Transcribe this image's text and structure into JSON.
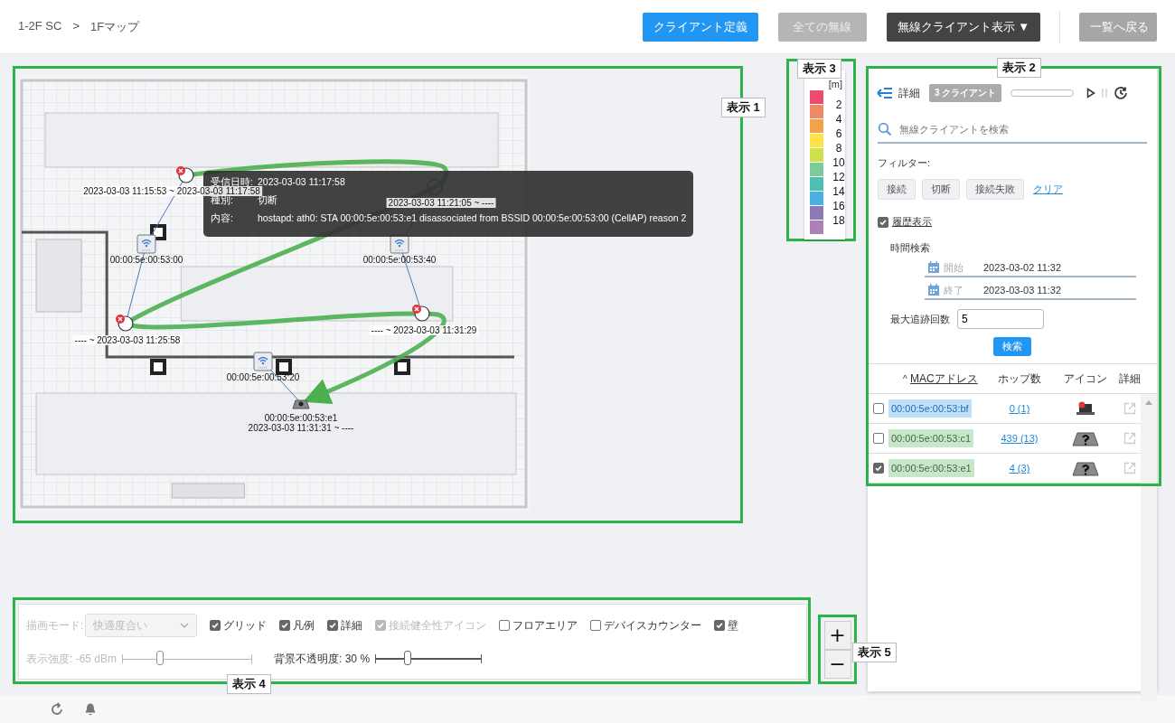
{
  "breadcrumb": {
    "items": [
      "1-2F SC",
      "1Fマップ"
    ],
    "separator": ">"
  },
  "header_buttons": [
    {
      "label": "クライアント定義",
      "kind": "primary"
    },
    {
      "label": "全ての無線",
      "kind": "disabled"
    },
    {
      "label": "無線クライアント表示 ▼",
      "kind": "dark"
    },
    {
      "label": "一覧へ戻る",
      "kind": "secondary"
    }
  ],
  "annotations": [
    "表示 1",
    "表示 2",
    "表示 3",
    "表示 4",
    "表示 5"
  ],
  "map": {
    "events": [
      {
        "kind": "error",
        "label": "2023-03-03 11:15:53 ~ 2023-03-03 11:17:58"
      },
      {
        "kind": "normal",
        "label": "2023-03-03 11:21:05 ~ ----"
      },
      {
        "kind": "error",
        "label": "---- ~ 2023-03-03 11:25:58"
      },
      {
        "kind": "error",
        "label": "---- ~ 2023-03-03 11:31:29"
      }
    ],
    "access_points": [
      "00:00:5e:00:53:00",
      "00:00:5e:00:53:40",
      "00:00:5e:00:53:20"
    ],
    "client": {
      "mac": "00:00:5e:00:53:e1",
      "time": "2023-03-03 11:31:31 ~ ----"
    },
    "tooltip": [
      {
        "key": "受信日時:",
        "value": "2023-03-03 11:17:58"
      },
      {
        "key": "種別:",
        "value": "切断"
      },
      {
        "key": "内容:",
        "value": "hostapd: ath0: STA 00:00:5e:00:53:e1 disassociated from BSSID 00:00:5e:00:53:00 (CellAP) reason 2"
      }
    ]
  },
  "legend": {
    "unit": "[m]",
    "swatches": [
      {
        "color": "#ef4b6c"
      },
      {
        "color": "#ef8a66"
      },
      {
        "color": "#f3a24b"
      },
      {
        "color": "#fde24c"
      },
      {
        "color": "#cfe04a"
      },
      {
        "color": "#7dcb98"
      },
      {
        "color": "#4dbfb5"
      },
      {
        "color": "#4ab1e2"
      },
      {
        "color": "#8f7ab8"
      },
      {
        "color": "#ad80b8"
      }
    ],
    "ticks": [
      "2",
      "4",
      "6",
      "8",
      "10",
      "12",
      "14",
      "16",
      "18"
    ]
  },
  "side_panel": {
    "title": "詳細",
    "client_count": "3 クライアント",
    "search": {
      "placeholder": "無線クライアントを検索"
    },
    "filter_label": "フィルター:",
    "filters": [
      "接続",
      "切断",
      "接続失敗"
    ],
    "clear": "クリア",
    "history": {
      "label": "履歴表示",
      "checked": true
    },
    "time_search": {
      "label": "時間検索",
      "start": {
        "label": "開始",
        "value": "2023-03-02 11:32"
      },
      "end": {
        "label": "終了",
        "value": "2023-03-03 11:32"
      }
    },
    "max_trace": {
      "label": "最大追跡回数",
      "value": "5"
    },
    "search_button": "検索",
    "table": {
      "columns": [
        {
          "label": "MACアドレス",
          "sort_icon": "^"
        },
        {
          "label": "ホップ数"
        },
        {
          "label": "アイコン"
        },
        {
          "label": "詳細"
        }
      ],
      "rows": [
        {
          "checked": false,
          "mac": "00:00:5e:00:53:bf",
          "color": "#bfe0fb",
          "hops": "0 (1)",
          "kind": "laptop-error"
        },
        {
          "checked": false,
          "mac": "00:00:5e:00:53:c1",
          "color": "#c8e6c9",
          "hops": "439 (13)",
          "kind": "unknown"
        },
        {
          "checked": true,
          "mac": "00:00:5e:00:53:e1",
          "color": "#c8e6c9",
          "hops": "4 (3)",
          "kind": "unknown"
        }
      ]
    }
  },
  "toolbar": {
    "draw_mode": {
      "label": "描画モード:",
      "value": "快適度合い",
      "disabled": true
    },
    "checkboxes": [
      {
        "label": "グリッド",
        "checked": true,
        "disabled": false
      },
      {
        "label": "凡例",
        "checked": true,
        "disabled": false
      },
      {
        "label": "詳細",
        "checked": true,
        "disabled": false
      },
      {
        "label": "接続健全性アイコン",
        "checked": true,
        "disabled": true
      },
      {
        "label": "フロアエリア",
        "checked": false,
        "disabled": false
      },
      {
        "label": "デバイスカウンター",
        "checked": false,
        "disabled": false
      },
      {
        "label": "壁",
        "checked": true,
        "disabled": false
      }
    ],
    "sliders": [
      {
        "label": "表示強度: -65 dBm",
        "level": 0.29,
        "disabled": true
      },
      {
        "label": "背景不透明度: 30 %",
        "level": 0.3,
        "disabled": false
      }
    ]
  },
  "zoom": [
    "+",
    "−"
  ]
}
